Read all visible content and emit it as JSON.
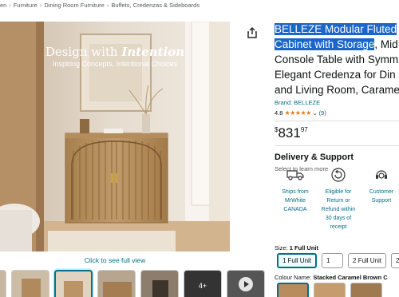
{
  "breadcrumb": [
    "en",
    "Furniture",
    "Dining Room Furniture",
    "Buffets, Credenzas & Sideboards"
  ],
  "breadcrumb_sep": "›",
  "hero": {
    "headline_a": "Design with ",
    "headline_b": "Intention",
    "subhead": "Inspiring Concepts, Intentional Choices",
    "click_caption": "Click to see full view"
  },
  "thumbs": {
    "more_label": "4+"
  },
  "product": {
    "title_highlighted": "BELLEZE Modular Fluted Cabinet with Storage",
    "title_rest": ", Mid Console Table with Symm Elegant Credenza for Din and Living Room, Carame",
    "brand": "Brand: BELLEZE",
    "rating_value": "4.8",
    "stars": "★★★★★",
    "rating_count": "(9)",
    "price_currency": "$",
    "price_whole": "831",
    "price_cents": "97"
  },
  "delivery": {
    "heading": "Delivery & Support",
    "learn": "Select to learn more",
    "features": [
      {
        "label": "Ships from MrWhite CANADA",
        "icon": "truck-icon"
      },
      {
        "label": "Eligible for Return or Refund within 30 days of receipt",
        "icon": "return-icon"
      },
      {
        "label": "Customer Support",
        "icon": "support-icon"
      }
    ]
  },
  "size": {
    "label": "Size: ",
    "value": "1 Full Unit",
    "options": [
      "1 Full Unit",
      "1",
      "2 Full Unit",
      "2"
    ]
  },
  "color": {
    "label": "Colour Name: ",
    "value": "Stacked Caramel Brown C"
  },
  "colors": {
    "accent": "#007185",
    "highlight": "#1a66c9",
    "star": "#de7921"
  }
}
